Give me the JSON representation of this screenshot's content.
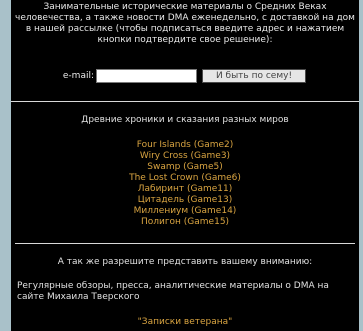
{
  "colors": {
    "background": "#000000",
    "page_outer": "#a9c1c9",
    "text": "#e0e0e0",
    "link": "#d9a441"
  },
  "subscription": {
    "intro": "Занимательные исторические материалы о Средних Веках человечества, а также новости DMA еженедельно, с доставкой на дом в нашей рассылке (чтобы подписаться введите адрес и нажатием кнопки подтвердите свое решение):",
    "email_label": "e-mail:",
    "email_value": "",
    "button_label": "И быть по сему!"
  },
  "chronicles": {
    "heading": "Древние хроники и сказания разных миров",
    "games": [
      "Four Islands (Game2)",
      "Wiry Cross (Game3)",
      "Swamp (Game5)",
      "The Lost Crown (Game6)",
      "Лабиринт (Game11)",
      "Цитадель (Game13)",
      "Миллениум (Game14)",
      "Полигон (Game15)"
    ]
  },
  "recommendation": {
    "heading": "А так же разрешите представить вашему вниманию:",
    "description": "Регулярные обзоры, пресса, аналитические материалы о DMA на сайте Михаила Тверского",
    "link_label": "\"Записки ветерана\""
  }
}
